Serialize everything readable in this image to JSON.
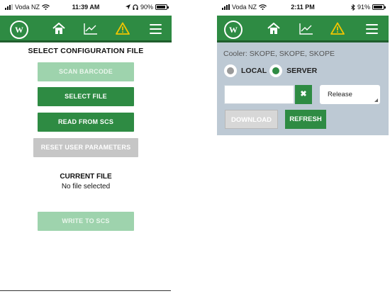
{
  "left_phone": {
    "status": {
      "carrier": "Voda NZ",
      "time": "11:39 AM",
      "battery": "90%",
      "battery_level": 0.9
    },
    "nav": {
      "logo_text": "W",
      "icons": [
        "logo-icon",
        "home-icon",
        "chart-icon",
        "warning-icon",
        "menu-icon"
      ]
    },
    "title": "SELECT CONFIGURATION FILE",
    "buttons": {
      "scan": "SCAN BARCODE",
      "select": "SELECT FILE",
      "read": "READ FROM SCS",
      "reset": "RESET USER PARAMETERS",
      "write": "WRITE TO SCS"
    },
    "current_file_label": "CURRENT FILE",
    "current_file_value": "No file selected"
  },
  "right_phone": {
    "status": {
      "carrier": "Voda NZ",
      "time": "2:11 PM",
      "battery": "91%",
      "battery_level": 0.91
    },
    "nav": {
      "logo_text": "W",
      "icons": [
        "logo-icon",
        "home-icon",
        "chart-icon",
        "warning-icon",
        "menu-icon"
      ]
    },
    "cooler_text": "Cooler: SKOPE, SKOPE, SKOPE",
    "radio": {
      "local_label": "LOCAL",
      "server_label": "SERVER",
      "selected": "SERVER"
    },
    "search_value": "",
    "clear_label": "✖",
    "release_value": "Release",
    "download_label": "DOWNLOAD",
    "refresh_label": "REFRESH"
  },
  "colors": {
    "brand_green": "#2e8b43",
    "pale_green": "#9ed3ad",
    "gray_button": "#c6c6c6",
    "panel_bg": "#bdc9d4",
    "warning_yellow": "#f2c500"
  }
}
